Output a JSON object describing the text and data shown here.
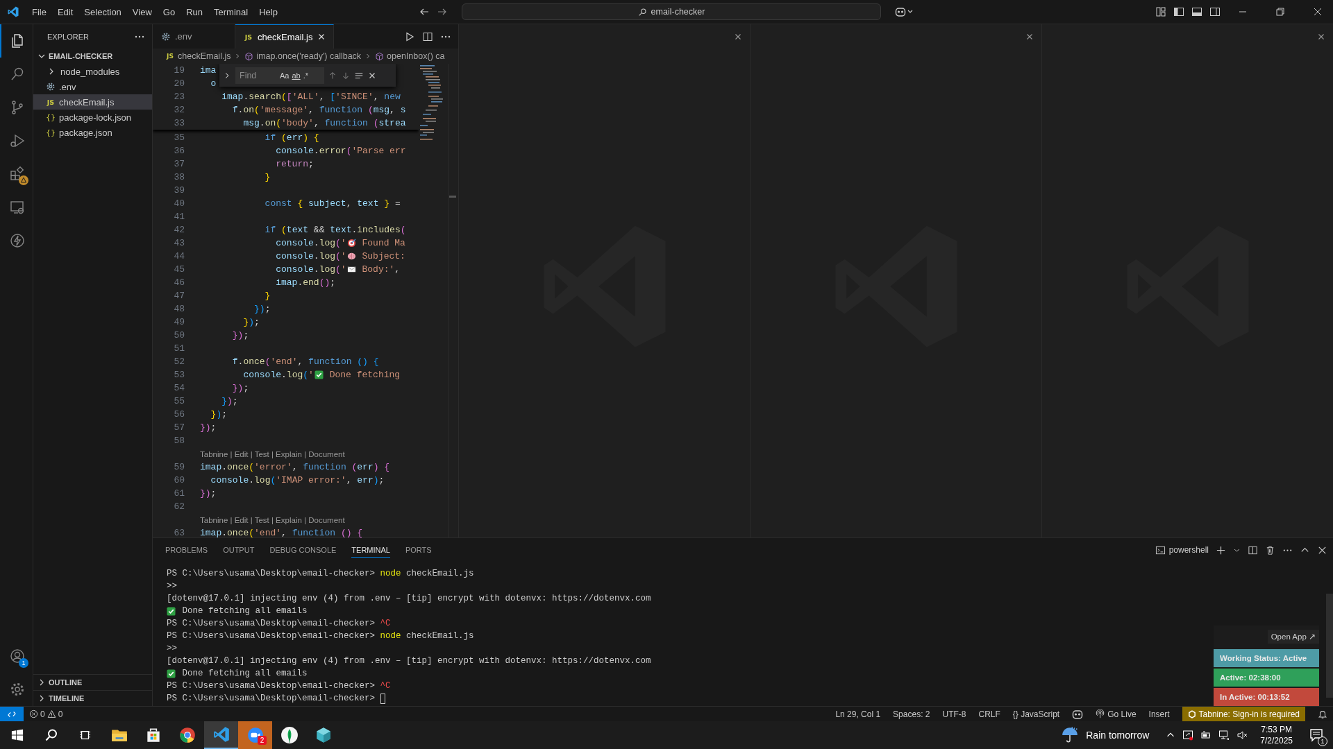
{
  "title_bar": {
    "menu": [
      "File",
      "Edit",
      "Selection",
      "View",
      "Go",
      "Run",
      "Terminal",
      "Help"
    ],
    "command_center": "email-checker"
  },
  "activity_bar": {
    "top": [
      {
        "kind": "explorer",
        "selected": true,
        "warning": false
      },
      {
        "kind": "search",
        "selected": false,
        "warning": false
      },
      {
        "kind": "source-control",
        "selected": false,
        "warning": false
      },
      {
        "kind": "run-debug",
        "selected": false,
        "warning": false
      },
      {
        "kind": "extensions",
        "selected": false,
        "warning": true
      },
      {
        "kind": "remote",
        "selected": false,
        "warning": false
      },
      {
        "kind": "lightning",
        "selected": false,
        "warning": false
      }
    ],
    "bottom": [
      {
        "kind": "accounts",
        "badge": "1"
      },
      {
        "kind": "settings"
      }
    ]
  },
  "sidebar": {
    "title": "EXPLORER",
    "root": {
      "label": "EMAIL-CHECKER",
      "expanded": true,
      "children": [
        {
          "label": "node_modules",
          "kind": "folder",
          "expanded": false,
          "selected": false
        },
        {
          "label": ".env",
          "kind": "env",
          "selected": false
        },
        {
          "label": "checkEmail.js",
          "kind": "file",
          "badge": "JS",
          "selected": true
        },
        {
          "label": "package-lock.json",
          "kind": "file",
          "badge": "{}",
          "selected": false
        },
        {
          "label": "package.json",
          "kind": "file",
          "badge": "{}",
          "selected": false
        }
      ]
    },
    "sections": [
      {
        "label": "OUTLINE",
        "expanded": false
      },
      {
        "label": "TIMELINE",
        "expanded": false
      }
    ]
  },
  "editor": {
    "tabs": [
      {
        "label": ".env",
        "kind": "env",
        "selected": false
      },
      {
        "label": "checkEmail.js",
        "kind": "file",
        "badge": "JS",
        "selected": true
      }
    ],
    "breadcrumb": [
      {
        "kind": "file",
        "badge": "JS",
        "label": "checkEmail.js"
      },
      {
        "kind": "symbol",
        "label": "imap.once('ready') callback"
      },
      {
        "kind": "symbol",
        "label": "openInbox() ca"
      }
    ],
    "find": {
      "placeholder": "Find",
      "options": [
        "Aa",
        "ab",
        ".*"
      ]
    },
    "sticky_lines": [
      {
        "n": "19",
        "tokens": [
          {
            "kind": "v",
            "text": "ima"
          }
        ]
      },
      {
        "n": "20",
        "tokens": [
          {
            "kind": "v",
            "text": "  o"
          }
        ]
      },
      {
        "n": "23",
        "tokens": [
          {
            "kind": "v",
            "text": "    imap"
          },
          {
            "kind": "p",
            "text": "."
          },
          {
            "kind": "f",
            "text": "search"
          },
          {
            "kind": "y",
            "text": "("
          },
          {
            "kind": "m",
            "text": "["
          },
          {
            "kind": "s",
            "text": "'ALL'"
          },
          {
            "kind": "p",
            "text": ", "
          },
          {
            "kind": "b",
            "text": "["
          },
          {
            "kind": "s",
            "text": "'SINCE'"
          },
          {
            "kind": "p",
            "text": ", "
          },
          {
            "kind": "k",
            "text": "new"
          }
        ]
      },
      {
        "n": "32",
        "tokens": [
          {
            "kind": "v",
            "text": "      f"
          },
          {
            "kind": "p",
            "text": "."
          },
          {
            "kind": "f",
            "text": "on"
          },
          {
            "kind": "y",
            "text": "("
          },
          {
            "kind": "s",
            "text": "'message'"
          },
          {
            "kind": "p",
            "text": ", "
          },
          {
            "kind": "k",
            "text": "function "
          },
          {
            "kind": "m",
            "text": "("
          },
          {
            "kind": "v",
            "text": "msg"
          },
          {
            "kind": "p",
            "text": ", "
          },
          {
            "kind": "v",
            "text": "s"
          }
        ]
      },
      {
        "n": "33",
        "tokens": [
          {
            "kind": "v",
            "text": "        msg"
          },
          {
            "kind": "p",
            "text": "."
          },
          {
            "kind": "f",
            "text": "on"
          },
          {
            "kind": "y",
            "text": "("
          },
          {
            "kind": "s",
            "text": "'body'"
          },
          {
            "kind": "p",
            "text": ", "
          },
          {
            "kind": "k",
            "text": "function "
          },
          {
            "kind": "m",
            "text": "("
          },
          {
            "kind": "v",
            "text": "strea"
          }
        ]
      }
    ],
    "lines": [
      {
        "kind": "code",
        "n": "35",
        "tokens": [
          {
            "kind": "k",
            "text": "            if "
          },
          {
            "kind": "y",
            "text": "("
          },
          {
            "kind": "v",
            "text": "err"
          },
          {
            "kind": "y",
            "text": ") {"
          }
        ]
      },
      {
        "kind": "code",
        "n": "36",
        "tokens": [
          {
            "kind": "v",
            "text": "              console"
          },
          {
            "kind": "p",
            "text": "."
          },
          {
            "kind": "f",
            "text": "error"
          },
          {
            "kind": "m",
            "text": "("
          },
          {
            "kind": "s",
            "text": "'Parse err"
          }
        ]
      },
      {
        "kind": "code",
        "n": "37",
        "tokens": [
          {
            "kind": "c",
            "text": "              return"
          },
          {
            "kind": "p",
            "text": ";"
          }
        ]
      },
      {
        "kind": "code",
        "n": "38",
        "tokens": [
          {
            "kind": "y",
            "text": "            }"
          }
        ]
      },
      {
        "kind": "code",
        "n": "39"
      },
      {
        "kind": "code",
        "n": "40",
        "tokens": [
          {
            "kind": "k",
            "text": "            const "
          },
          {
            "kind": "y",
            "text": "{ "
          },
          {
            "kind": "v",
            "text": "subject"
          },
          {
            "kind": "p",
            "text": ", "
          },
          {
            "kind": "v",
            "text": "text "
          },
          {
            "kind": "y",
            "text": "}"
          },
          {
            "kind": "p",
            "text": " ="
          }
        ]
      },
      {
        "kind": "code",
        "n": "41"
      },
      {
        "kind": "code",
        "n": "42",
        "tokens": [
          {
            "kind": "k",
            "text": "            if "
          },
          {
            "kind": "y",
            "text": "("
          },
          {
            "kind": "v",
            "text": "text"
          },
          {
            "kind": "p",
            "text": " && "
          },
          {
            "kind": "v",
            "text": "text"
          },
          {
            "kind": "p",
            "text": "."
          },
          {
            "kind": "f",
            "text": "includes"
          },
          {
            "kind": "m",
            "text": "("
          }
        ]
      },
      {
        "kind": "code",
        "n": "43",
        "tokens": [
          {
            "kind": "v",
            "text": "              console"
          },
          {
            "kind": "p",
            "text": "."
          },
          {
            "kind": "f",
            "text": "log"
          },
          {
            "kind": "m",
            "text": "("
          },
          {
            "kind": "s",
            "text": "'"
          },
          {
            "kind": "target"
          },
          {
            "kind": "s",
            "text": " Found Ma"
          }
        ]
      },
      {
        "kind": "code",
        "n": "44",
        "tokens": [
          {
            "kind": "v",
            "text": "              console"
          },
          {
            "kind": "p",
            "text": "."
          },
          {
            "kind": "f",
            "text": "log"
          },
          {
            "kind": "m",
            "text": "("
          },
          {
            "kind": "s",
            "text": "'"
          },
          {
            "kind": "brain"
          },
          {
            "kind": "s",
            "text": " Subject:"
          }
        ]
      },
      {
        "kind": "code",
        "n": "45",
        "tokens": [
          {
            "kind": "v",
            "text": "              console"
          },
          {
            "kind": "p",
            "text": "."
          },
          {
            "kind": "f",
            "text": "log"
          },
          {
            "kind": "m",
            "text": "("
          },
          {
            "kind": "s",
            "text": "'"
          },
          {
            "kind": "envelope"
          },
          {
            "kind": "s",
            "text": " Body:'"
          },
          {
            "kind": "p",
            "text": ","
          }
        ]
      },
      {
        "kind": "code",
        "n": "46",
        "tokens": [
          {
            "kind": "v",
            "text": "              imap"
          },
          {
            "kind": "p",
            "text": "."
          },
          {
            "kind": "f",
            "text": "end"
          },
          {
            "kind": "m",
            "text": "()"
          },
          {
            "kind": "p",
            "text": ";"
          }
        ]
      },
      {
        "kind": "code",
        "n": "47",
        "tokens": [
          {
            "kind": "y",
            "text": "            }"
          }
        ]
      },
      {
        "kind": "code",
        "n": "48",
        "tokens": [
          {
            "kind": "b",
            "text": "          })"
          },
          {
            "kind": "p",
            "text": ";"
          }
        ]
      },
      {
        "kind": "code",
        "n": "49",
        "tokens": [
          {
            "kind": "y",
            "text": "        }"
          },
          {
            "kind": "b",
            "text": ")"
          },
          {
            "kind": "p",
            "text": ";"
          }
        ]
      },
      {
        "kind": "code",
        "n": "50",
        "tokens": [
          {
            "kind": "m",
            "text": "      })"
          },
          {
            "kind": "p",
            "text": ";"
          }
        ]
      },
      {
        "kind": "code",
        "n": "51"
      },
      {
        "kind": "code",
        "n": "52",
        "tokens": [
          {
            "kind": "v",
            "text": "      f"
          },
          {
            "kind": "p",
            "text": "."
          },
          {
            "kind": "f",
            "text": "once"
          },
          {
            "kind": "m",
            "text": "("
          },
          {
            "kind": "s",
            "text": "'end'"
          },
          {
            "kind": "p",
            "text": ", "
          },
          {
            "kind": "k",
            "text": "function "
          },
          {
            "kind": "b",
            "text": "() {"
          }
        ]
      },
      {
        "kind": "code",
        "n": "53",
        "tokens": [
          {
            "kind": "v",
            "text": "        console"
          },
          {
            "kind": "p",
            "text": "."
          },
          {
            "kind": "f",
            "text": "log"
          },
          {
            "kind": "b",
            "text": "("
          },
          {
            "kind": "s",
            "text": "'"
          },
          {
            "kind": "check"
          },
          {
            "kind": "s",
            "text": " Done fetching"
          }
        ]
      },
      {
        "kind": "code",
        "n": "54",
        "tokens": [
          {
            "kind": "m",
            "text": "      })"
          },
          {
            "kind": "p",
            "text": ";"
          }
        ]
      },
      {
        "kind": "code",
        "n": "55",
        "tokens": [
          {
            "kind": "b",
            "text": "    }"
          },
          {
            "kind": "m",
            "text": ")"
          },
          {
            "kind": "p",
            "text": ";"
          }
        ]
      },
      {
        "kind": "code",
        "n": "56",
        "tokens": [
          {
            "kind": "y",
            "text": "  }"
          },
          {
            "kind": "b",
            "text": ")"
          },
          {
            "kind": "p",
            "text": ";"
          }
        ]
      },
      {
        "kind": "code",
        "n": "57",
        "tokens": [
          {
            "kind": "m",
            "text": "})"
          },
          {
            "kind": "p",
            "text": ";"
          }
        ]
      },
      {
        "kind": "code",
        "n": "58"
      },
      {
        "kind": "lens",
        "text": "Tabnine | Edit | Test | Explain | Document"
      },
      {
        "kind": "code",
        "n": "59",
        "tokens": [
          {
            "kind": "v",
            "text": "imap"
          },
          {
            "kind": "p",
            "text": "."
          },
          {
            "kind": "f",
            "text": "once"
          },
          {
            "kind": "y",
            "text": "("
          },
          {
            "kind": "s",
            "text": "'error'"
          },
          {
            "kind": "p",
            "text": ", "
          },
          {
            "kind": "k",
            "text": "function "
          },
          {
            "kind": "m",
            "text": "("
          },
          {
            "kind": "v",
            "text": "err"
          },
          {
            "kind": "m",
            "text": ") {"
          }
        ]
      },
      {
        "kind": "code",
        "n": "60",
        "tokens": [
          {
            "kind": "v",
            "text": "  console"
          },
          {
            "kind": "p",
            "text": "."
          },
          {
            "kind": "f",
            "text": "log"
          },
          {
            "kind": "b",
            "text": "("
          },
          {
            "kind": "s",
            "text": "'IMAP error:'"
          },
          {
            "kind": "p",
            "text": ", "
          },
          {
            "kind": "v",
            "text": "err"
          },
          {
            "kind": "b",
            "text": ")"
          },
          {
            "kind": "p",
            "text": ";"
          }
        ]
      },
      {
        "kind": "code",
        "n": "61",
        "tokens": [
          {
            "kind": "m",
            "text": "})"
          },
          {
            "kind": "p",
            "text": ";"
          }
        ]
      },
      {
        "kind": "code",
        "n": "62"
      },
      {
        "kind": "lens",
        "text": "Tabnine | Edit | Test | Explain | Document"
      },
      {
        "kind": "code",
        "n": "63",
        "tokens": [
          {
            "kind": "v",
            "text": "imap"
          },
          {
            "kind": "p",
            "text": "."
          },
          {
            "kind": "f",
            "text": "once"
          },
          {
            "kind": "y",
            "text": "("
          },
          {
            "kind": "s",
            "text": "'end'"
          },
          {
            "kind": "p",
            "text": ", "
          },
          {
            "kind": "k",
            "text": "function "
          },
          {
            "kind": "m",
            "text": "() {"
          }
        ]
      }
    ]
  },
  "editor_groups": [
    {
      "kind": "empty"
    },
    {
      "kind": "empty"
    },
    {
      "kind": "empty"
    }
  ],
  "panel": {
    "tabs": [
      {
        "label": "PROBLEMS",
        "selected": false
      },
      {
        "label": "OUTPUT",
        "selected": false
      },
      {
        "label": "DEBUG CONSOLE",
        "selected": false
      },
      {
        "label": "TERMINAL",
        "selected": true
      },
      {
        "label": "PORTS",
        "selected": false
      }
    ],
    "terminal_name": "powershell",
    "lines": [
      [
        {
          "kind": "p",
          "text": "PS C:\\Users\\usama\\Desktop\\email-checker> "
        },
        {
          "kind": "y",
          "text": "node"
        },
        {
          "kind": "p",
          "text": " checkEmail.js"
        }
      ],
      [
        {
          "kind": "p",
          "text": ">>"
        }
      ],
      [
        {
          "kind": "p",
          "text": "[dotenv@17.0.1] injecting env (4) from .env – [tip] encrypt with dotenvx: https://dotenvx.com"
        }
      ],
      [
        {
          "kind": "check"
        },
        {
          "kind": "p",
          "text": " Done fetching all emails"
        }
      ],
      [
        {
          "kind": "p",
          "text": "PS C:\\Users\\usama\\Desktop\\email-checker> "
        },
        {
          "kind": "r",
          "text": "^C"
        }
      ],
      [
        {
          "kind": "p",
          "text": "PS C:\\Users\\usama\\Desktop\\email-checker> "
        },
        {
          "kind": "y",
          "text": "node"
        },
        {
          "kind": "p",
          "text": " checkEmail.js"
        }
      ],
      [
        {
          "kind": "p",
          "text": ">>"
        }
      ],
      [
        {
          "kind": "p",
          "text": "[dotenv@17.0.1] injecting env (4) from .env – [tip] encrypt with dotenvx: https://dotenvx.com"
        }
      ],
      [
        {
          "kind": "check"
        },
        {
          "kind": "p",
          "text": " Done fetching all emails"
        }
      ],
      [
        {
          "kind": "p",
          "text": "PS C:\\Users\\usama\\Desktop\\email-checker> "
        },
        {
          "kind": "r",
          "text": "^C"
        }
      ],
      [
        {
          "kind": "p",
          "text": "PS C:\\Users\\usama\\Desktop\\email-checker> "
        },
        {
          "kind": "cursor"
        }
      ]
    ]
  },
  "overlay": {
    "button": "Open App ↗",
    "items": [
      {
        "label": "Working Status: Active",
        "color": "#4e9ba6"
      },
      {
        "label": "Active: 02:38:00",
        "color": "#2fa05a"
      },
      {
        "label": "In Active: 00:13:52",
        "color": "#c2493c"
      }
    ]
  },
  "status_bar": {
    "errors": "0",
    "warnings": "0",
    "items": [
      {
        "kind": "text",
        "label": "Ln 29, Col 1"
      },
      {
        "kind": "text",
        "label": "Spaces: 2"
      },
      {
        "kind": "text",
        "label": "UTF-8"
      },
      {
        "kind": "text",
        "label": "CRLF"
      },
      {
        "kind": "text",
        "label": "{} JavaScript"
      },
      {
        "kind": "copilot"
      },
      {
        "kind": "live",
        "label": "Go Live"
      },
      {
        "kind": "text",
        "label": "Insert"
      },
      {
        "kind": "warning",
        "label": "Tabnine: Sign-in is required"
      },
      {
        "kind": "bell"
      }
    ]
  },
  "taskbar": {
    "apps": [
      {
        "kind": "files",
        "selected": false,
        "attention": false
      },
      {
        "kind": "store",
        "selected": false,
        "attention": false
      },
      {
        "kind": "browser",
        "selected": false,
        "attention": false
      },
      {
        "kind": "code",
        "selected": true,
        "attention": false
      },
      {
        "kind": "video",
        "selected": false,
        "attention": true,
        "badge": "2"
      },
      {
        "kind": "leaf",
        "selected": false,
        "attention": false
      },
      {
        "kind": "cube",
        "selected": false,
        "attention": false
      }
    ],
    "weather": "Rain tomorrow",
    "time": "7:53 PM",
    "date": "7/2/2025",
    "notifications": "1"
  }
}
